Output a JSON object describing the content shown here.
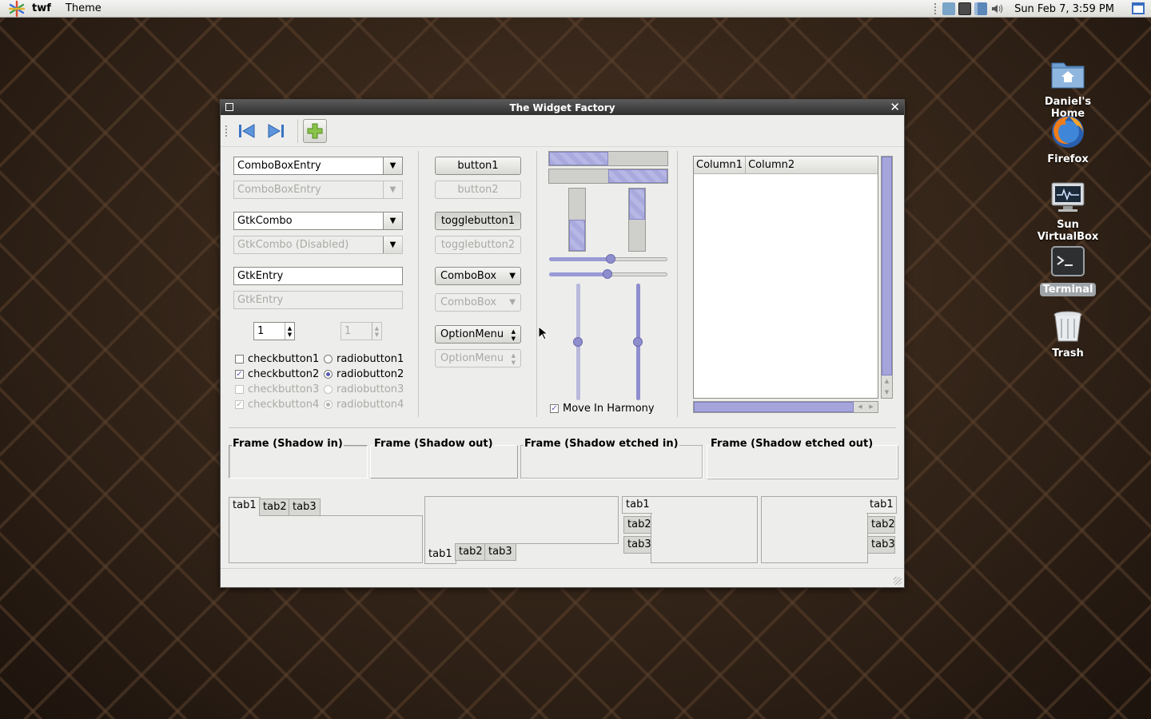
{
  "panel": {
    "app_name": "twf",
    "menu_theme": "Theme",
    "clock": "Sun Feb  7,  3:59 PM"
  },
  "desktop": {
    "icons": [
      {
        "label": "Daniel's Home",
        "icon": "home-folder-icon"
      },
      {
        "label": "Firefox",
        "icon": "firefox-icon"
      },
      {
        "label": "Sun VirtualBox",
        "icon": "virtualbox-icon"
      },
      {
        "label": "Terminal",
        "icon": "terminal-icon"
      },
      {
        "label": "Trash",
        "icon": "trash-icon"
      }
    ]
  },
  "window": {
    "title": "The Widget Factory",
    "toolbar": {
      "icons": [
        "go-first-icon",
        "go-last-icon",
        "add-icon"
      ]
    },
    "combo_entry": {
      "value": "ComboBoxEntry",
      "disabled_value": "ComboBoxEntry"
    },
    "gtk_combo": {
      "value": "GtkCombo",
      "disabled_value": "GtkCombo (Disabled)"
    },
    "entry": {
      "value": "GtkEntry",
      "disabled_value": "GtkEntry"
    },
    "spin": {
      "value": "1",
      "disabled_value": "1"
    },
    "checks": [
      {
        "label": "checkbutton1",
        "checked": false,
        "disabled": false
      },
      {
        "label": "checkbutton2",
        "checked": true,
        "disabled": false
      },
      {
        "label": "checkbutton3",
        "checked": false,
        "disabled": true
      },
      {
        "label": "checkbutton4",
        "checked": true,
        "disabled": true
      }
    ],
    "radios": [
      {
        "label": "radiobutton1",
        "checked": false,
        "disabled": false
      },
      {
        "label": "radiobutton2",
        "checked": true,
        "disabled": false
      },
      {
        "label": "radiobutton3",
        "checked": false,
        "disabled": true
      },
      {
        "label": "radiobutton4",
        "checked": true,
        "disabled": true
      }
    ],
    "buttons": {
      "button1": "button1",
      "button2": "button2",
      "toggle1": "togglebutton1",
      "toggle2": "togglebutton2",
      "combobox": "ComboBox",
      "combobox_dis": "ComboBox",
      "optionmenu": "OptionMenu",
      "optionmenu_dis": "OptionMenu"
    },
    "progress": {
      "h1": 0.5,
      "h2": 0.5,
      "v1": 0.5,
      "v2": 0.5
    },
    "sliders": {
      "h1": 0.52,
      "h2": 0.49,
      "v1": 0.5,
      "v2": 0.5
    },
    "harmony": {
      "label": "Move In Harmony",
      "checked": true
    },
    "tree": {
      "columns": [
        "Column1",
        "Column2"
      ]
    },
    "frames": [
      "Frame (Shadow in)",
      "Frame (Shadow out)",
      "Frame (Shadow etched in)",
      "Frame (Shadow etched out)"
    ],
    "tabs": [
      "tab1",
      "tab2",
      "tab3"
    ]
  }
}
